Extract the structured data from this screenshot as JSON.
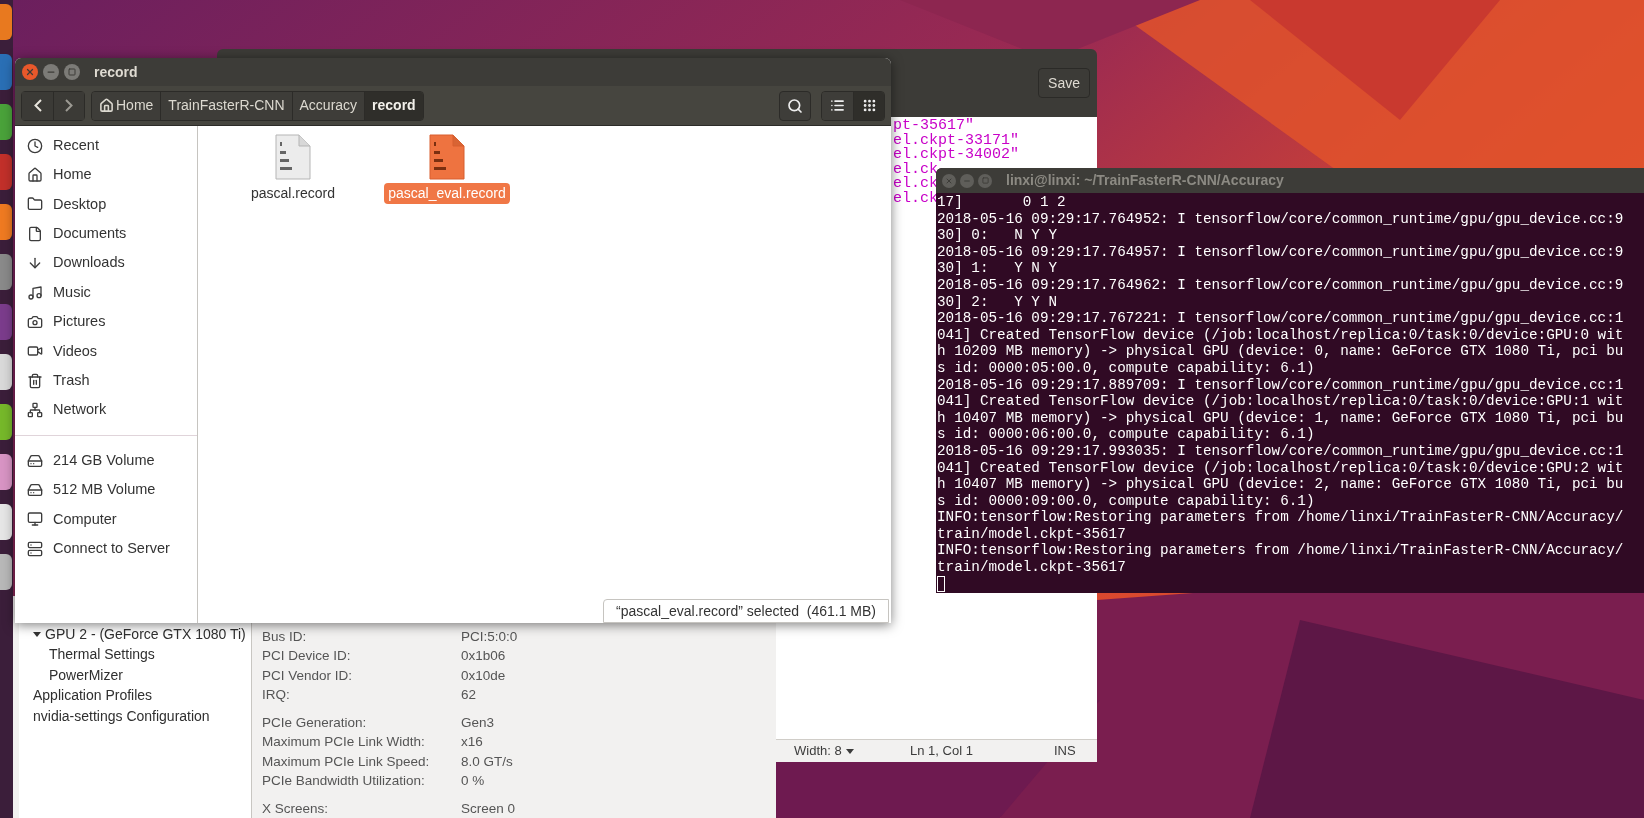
{
  "editor": {
    "save_button": "Save",
    "lines": [
      "pt-35617\"",
      "el.ckpt-33171\"",
      "el.ckpt-34002\"",
      "el.ck",
      "el.ck",
      "el.ck"
    ],
    "status_bar": {
      "tab_width": "Width: 8",
      "position": "Ln 1, Col 1",
      "mode": "INS"
    }
  },
  "nvidia_settings": {
    "tree": [
      {
        "label": "GPU 2 - (GeForce GTX 1080 Ti)",
        "expanded": true,
        "children": [
          {
            "label": "Thermal Settings"
          },
          {
            "label": "PowerMizer"
          }
        ]
      },
      {
        "label": "Application Profiles"
      },
      {
        "label": "nvidia-settings Configuration"
      }
    ],
    "groups": [
      [
        {
          "label": "Bus ID:",
          "value": "PCI:5:0:0"
        },
        {
          "label": "PCI Device ID:",
          "value": "0x1b06"
        },
        {
          "label": "PCI Vendor ID:",
          "value": "0x10de"
        },
        {
          "label": "IRQ:",
          "value": "62"
        }
      ],
      [
        {
          "label": "PCIe Generation:",
          "value": "Gen3"
        },
        {
          "label": "Maximum PCIe Link Width:",
          "value": "x16"
        },
        {
          "label": "Maximum PCIe Link Speed:",
          "value": "8.0 GT/s"
        },
        {
          "label": "PCIe Bandwidth Utilization:",
          "value": "0 %"
        }
      ],
      [
        {
          "label": "X Screens:",
          "value": "Screen 0"
        }
      ]
    ]
  },
  "file_manager": {
    "title": "record",
    "breadcrumbs": [
      {
        "kind": "home",
        "label": "Home",
        "selected": false
      },
      {
        "kind": "folder",
        "label": "TrainFasterR-CNN",
        "selected": false
      },
      {
        "kind": "folder",
        "label": "Accuracy",
        "selected": false
      },
      {
        "kind": "folder",
        "label": "record",
        "selected": true
      }
    ],
    "views": [
      {
        "kind": "list",
        "selected": false
      },
      {
        "kind": "grid",
        "selected": true
      }
    ],
    "places": [
      {
        "kind": "recent",
        "label": "Recent"
      },
      {
        "kind": "home",
        "label": "Home"
      },
      {
        "kind": "desktop",
        "label": "Desktop"
      },
      {
        "kind": "documents",
        "label": "Documents"
      },
      {
        "kind": "downloads",
        "label": "Downloads"
      },
      {
        "kind": "music",
        "label": "Music"
      },
      {
        "kind": "pictures",
        "label": "Pictures"
      },
      {
        "kind": "videos",
        "label": "Videos"
      },
      {
        "kind": "trash",
        "label": "Trash"
      },
      {
        "kind": "network",
        "label": "Network"
      }
    ],
    "devices": [
      {
        "kind": "volume",
        "label": "214 GB Volume"
      },
      {
        "kind": "volume",
        "label": "512 MB Volume"
      },
      {
        "kind": "computer",
        "label": "Computer"
      },
      {
        "kind": "server",
        "label": "Connect to Server"
      }
    ],
    "files": [
      {
        "name": "pascal.record",
        "selected": false
      },
      {
        "name": "pascal_eval.record",
        "selected": true
      }
    ],
    "status": "“pascal_eval.record” selected  (461.1 MB)"
  },
  "terminal": {
    "title": "linxi@linxi: ~/TrainFasterR-CNN/Accuracy",
    "cursor": true,
    "lines": [
      "17]       0 1 2",
      "2018-05-16 09:29:17.764952: I tensorflow/core/common_runtime/gpu/gpu_device.cc:9",
      "30] 0:   N Y Y",
      "2018-05-16 09:29:17.764957: I tensorflow/core/common_runtime/gpu/gpu_device.cc:9",
      "30] 1:   Y N Y",
      "2018-05-16 09:29:17.764962: I tensorflow/core/common_runtime/gpu/gpu_device.cc:9",
      "30] 2:   Y Y N",
      "2018-05-16 09:29:17.767221: I tensorflow/core/common_runtime/gpu/gpu_device.cc:1",
      "041] Created TensorFlow device (/job:localhost/replica:0/task:0/device:GPU:0 wit",
      "h 10209 MB memory) -> physical GPU (device: 0, name: GeForce GTX 1080 Ti, pci bu",
      "s id: 0000:05:00.0, compute capability: 6.1)",
      "2018-05-16 09:29:17.889709: I tensorflow/core/common_runtime/gpu/gpu_device.cc:1",
      "041] Created TensorFlow device (/job:localhost/replica:0/task:0/device:GPU:1 wit",
      "h 10407 MB memory) -> physical GPU (device: 1, name: GeForce GTX 1080 Ti, pci bu",
      "s id: 0000:06:00.0, compute capability: 6.1)",
      "2018-05-16 09:29:17.993035: I tensorflow/core/common_runtime/gpu/gpu_device.cc:1",
      "041] Created TensorFlow device (/job:localhost/replica:0/task:0/device:GPU:2 wit",
      "h 10407 MB memory) -> physical GPU (device: 2, name: GeForce GTX 1080 Ti, pci bu",
      "s id: 0000:09:00.0, compute capability: 6.1)",
      "INFO:tensorflow:Restoring parameters from /home/linxi/TrainFasterR-CNN/Accuracy/",
      "train/model.ckpt-35617",
      "INFO:tensorflow:Restoring parameters from /home/linxi/TrainFasterR-CNN/Accuracy/",
      "train/model.ckpt-35617"
    ]
  }
}
